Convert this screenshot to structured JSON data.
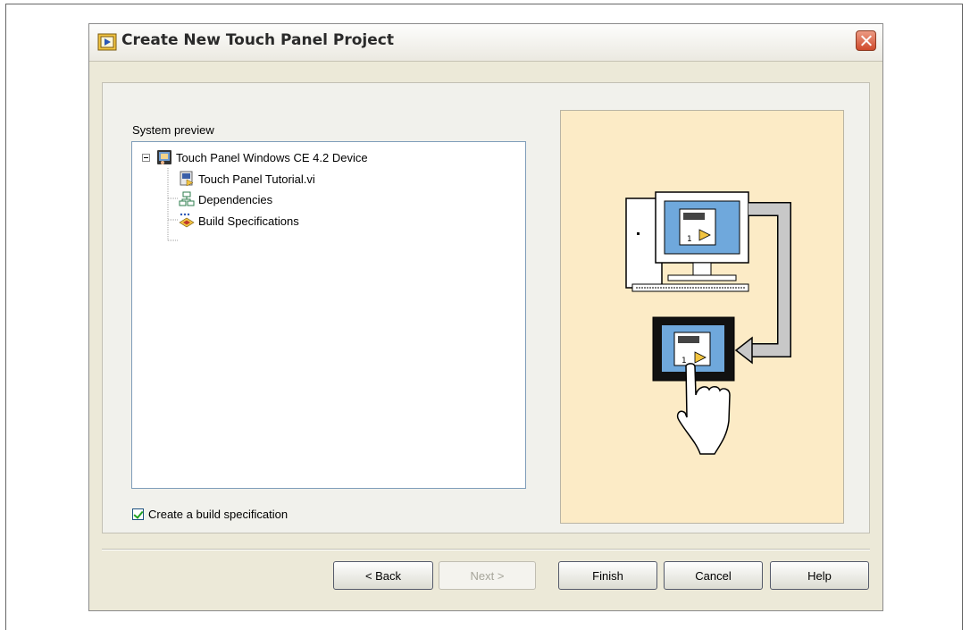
{
  "window": {
    "title": "Create New Touch Panel Project",
    "icon": "labview-app-icon",
    "close_icon": "close-icon"
  },
  "preview": {
    "label": "System preview",
    "tree": [
      {
        "label": "Touch Panel Windows CE 4.2 Device",
        "icon": "touch-panel-device-icon",
        "expanded": true
      },
      {
        "label": "Touch Panel Tutorial.vi",
        "icon": "vi-file-icon"
      },
      {
        "label": "Dependencies",
        "icon": "dependencies-icon"
      },
      {
        "label": "Build Specifications",
        "icon": "build-specifications-icon"
      }
    ]
  },
  "options": {
    "create_build_spec_label": "Create a build specification",
    "create_build_spec_checked": true
  },
  "illustration": {
    "monitor_screen_value": "1",
    "touch_panel_screen_value": "1",
    "background_color": "#fcebc6"
  },
  "buttons": {
    "back": "< Back",
    "next": "Next >",
    "finish": "Finish",
    "cancel": "Cancel",
    "help": "Help"
  }
}
